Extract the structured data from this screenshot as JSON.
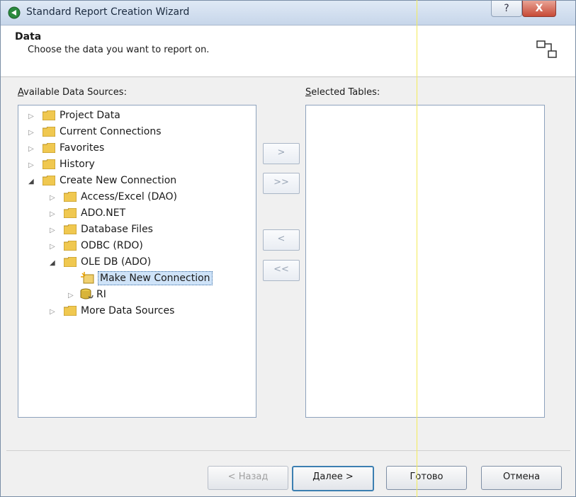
{
  "window": {
    "title": "Standard Report Creation Wizard",
    "help_button": "?",
    "close_button": "X"
  },
  "header": {
    "title": "Data",
    "subtitle": "Choose the data you want to report on."
  },
  "available": {
    "label_prefix": "A",
    "label_rest": "vailable Data Sources:",
    "tree": [
      {
        "label": "Project Data",
        "expander": "▷"
      },
      {
        "label": "Current Connections",
        "expander": "▷"
      },
      {
        "label": "Favorites",
        "expander": "▷"
      },
      {
        "label": "History",
        "expander": "▷"
      },
      {
        "label": "Create New Connection",
        "expander": "◢"
      },
      {
        "label": "Access/Excel (DAO)",
        "expander": "▷"
      },
      {
        "label": "ADO.NET",
        "expander": "▷"
      },
      {
        "label": "Database Files",
        "expander": "▷"
      },
      {
        "label": "ODBC (RDO)",
        "expander": "▷"
      },
      {
        "label": "OLE DB (ADO)",
        "expander": "◢"
      },
      {
        "label": "Make New Connection",
        "expander": ""
      },
      {
        "label": "RI",
        "expander": "▷"
      },
      {
        "label": "More Data Sources",
        "expander": "▷"
      }
    ]
  },
  "selected": {
    "label_prefix": "S",
    "label_rest": "elected Tables:"
  },
  "transfer": {
    "add": ">",
    "add_all": ">>",
    "remove": "<",
    "remove_all": "<<"
  },
  "footer": {
    "back": "< Назад",
    "next": "Далее >",
    "finish": "Готово",
    "cancel": "Отмена"
  }
}
